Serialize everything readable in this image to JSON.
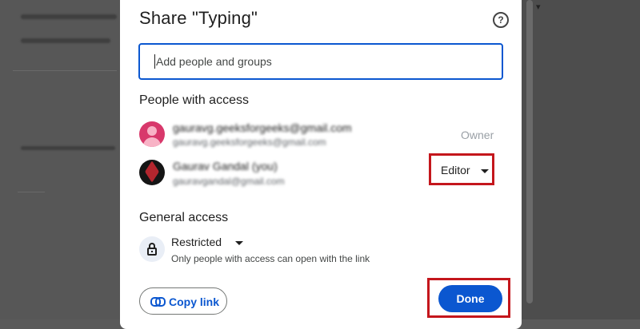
{
  "dialog": {
    "title": "Share \"Typing\"",
    "help_icon_glyph": "?",
    "add_placeholder": "Add people and groups"
  },
  "people_section": {
    "heading": "People with access",
    "people": [
      {
        "name": "gauravg.geeksforgeeks@gmail.com",
        "email": "gauravg.geeksforgeeks@gmail.com",
        "role": "Owner",
        "avatar_color": "#d8386b"
      },
      {
        "name": "Gaurav Gandal (you)",
        "email": "gauravgandal@gmail.com",
        "role": "Editor",
        "avatar_color": "#151515"
      }
    ]
  },
  "general_access": {
    "heading": "General access",
    "level": "Restricted",
    "description": "Only people with access can open with the link"
  },
  "footer": {
    "copy_link_label": "Copy link",
    "done_label": "Done"
  },
  "colors": {
    "accent": "#0b57d0",
    "highlight_border": "#c4161c"
  },
  "icons": [
    "help-icon",
    "person-icon",
    "dropdown-arrow-icon",
    "lock-icon",
    "link-icon"
  ]
}
